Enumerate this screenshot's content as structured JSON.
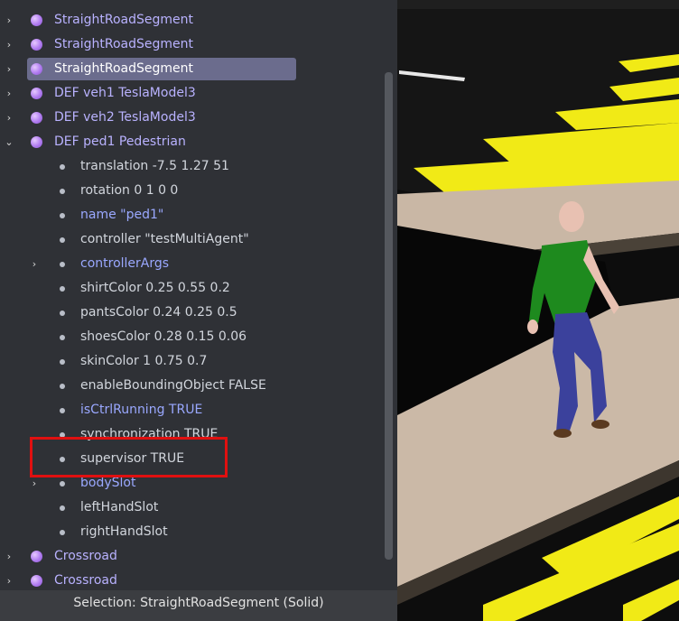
{
  "scene_tree": {
    "rows": [
      {
        "type": "node",
        "indent": 0,
        "expander": "›",
        "label": "StraightRoadSegment"
      },
      {
        "type": "node",
        "indent": 0,
        "expander": "›",
        "label": "StraightRoadSegment"
      },
      {
        "type": "node",
        "indent": 0,
        "expander": "›",
        "label": "StraightRoadSegment",
        "selected": true
      },
      {
        "type": "node",
        "indent": 0,
        "expander": "›",
        "label": "DEF veh1 TeslaModel3"
      },
      {
        "type": "node",
        "indent": 0,
        "expander": "›",
        "label": "DEF veh2 TeslaModel3"
      },
      {
        "type": "node",
        "indent": 0,
        "expander": "⌄",
        "label": "DEF ped1 Pedestrian"
      },
      {
        "type": "field",
        "indent": 1,
        "label": "translation -7.5 1.27 51"
      },
      {
        "type": "field",
        "indent": 1,
        "label": "rotation 0 1 0 0"
      },
      {
        "type": "field",
        "indent": 1,
        "label": "name \"ped1\"",
        "link": true
      },
      {
        "type": "field",
        "indent": 1,
        "label": "controller \"testMultiAgent\""
      },
      {
        "type": "field",
        "indent": 1,
        "expander": "›",
        "label": "controllerArgs",
        "link": true
      },
      {
        "type": "field",
        "indent": 1,
        "label": "shirtColor 0.25 0.55 0.2"
      },
      {
        "type": "field",
        "indent": 1,
        "label": "pantsColor 0.24 0.25 0.5"
      },
      {
        "type": "field",
        "indent": 1,
        "label": "shoesColor 0.28 0.15 0.06"
      },
      {
        "type": "field",
        "indent": 1,
        "label": "skinColor 1 0.75 0.7"
      },
      {
        "type": "field",
        "indent": 1,
        "label": "enableBoundingObject FALSE"
      },
      {
        "type": "field",
        "indent": 1,
        "label": "isCtrlRunning TRUE",
        "link": true
      },
      {
        "type": "field",
        "indent": 1,
        "label": "synchronization TRUE"
      },
      {
        "type": "field",
        "indent": 1,
        "label": "supervisor TRUE",
        "highlighted": true
      },
      {
        "type": "field",
        "indent": 1,
        "expander": "›",
        "label": "bodySlot",
        "link": true
      },
      {
        "type": "field",
        "indent": 1,
        "label": "leftHandSlot"
      },
      {
        "type": "field",
        "indent": 1,
        "label": "rightHandSlot"
      },
      {
        "type": "node",
        "indent": 0,
        "expander": "›",
        "label": "Crossroad"
      },
      {
        "type": "node",
        "indent": 0,
        "expander": "›",
        "label": "Crossroad"
      }
    ]
  },
  "status_bar": {
    "text": "Selection: StraightRoadSegment (Solid)"
  },
  "viewport": {
    "description_icon": "3d-scene",
    "colors": {
      "road": "#111111",
      "crosswalk": "#f1ea16",
      "sidewalk": "#c8b6a4",
      "shirt": "#1e8a1e",
      "pants": "#3a3f9e",
      "skin": "#f0c8b8"
    }
  }
}
